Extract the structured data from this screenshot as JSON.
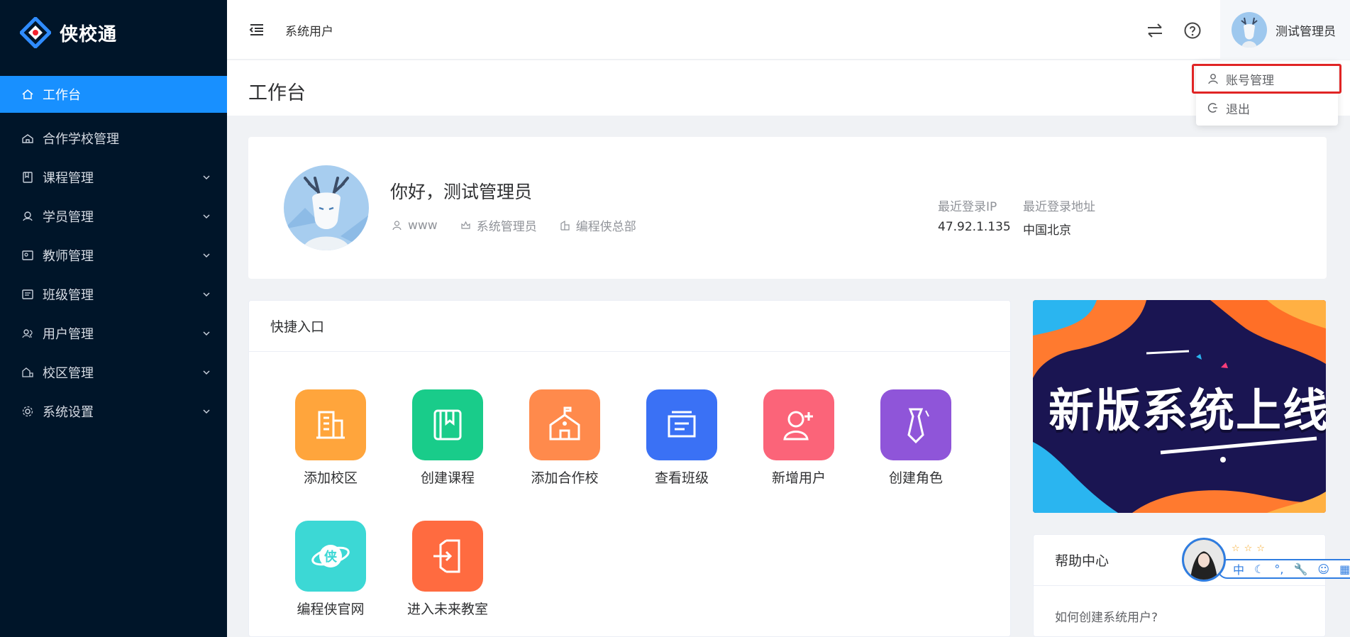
{
  "app": {
    "name": "侠校通"
  },
  "sidebar": {
    "items": [
      {
        "label": "工作台",
        "icon": "home-icon",
        "active": true
      },
      {
        "label": "合作学校管理",
        "icon": "school-icon"
      },
      {
        "label": "课程管理",
        "icon": "book-icon",
        "expandable": true
      },
      {
        "label": "学员管理",
        "icon": "student-icon",
        "expandable": true
      },
      {
        "label": "教师管理",
        "icon": "teacher-icon",
        "expandable": true
      },
      {
        "label": "班级管理",
        "icon": "class-icon",
        "expandable": true
      },
      {
        "label": "用户管理",
        "icon": "users-icon",
        "expandable": true
      },
      {
        "label": "校区管理",
        "icon": "campus-icon",
        "expandable": true
      },
      {
        "label": "系统设置",
        "icon": "gear-icon",
        "expandable": true
      }
    ]
  },
  "header": {
    "breadcrumb": "系统用户",
    "username": "测试管理员"
  },
  "dropdown": {
    "items": [
      {
        "label": "账号管理",
        "icon": "user-icon"
      },
      {
        "label": "退出",
        "icon": "logout-icon"
      }
    ]
  },
  "page": {
    "title": "工作台"
  },
  "welcome": {
    "greeting": "你好，测试管理员",
    "account": "www",
    "role": "系统管理员",
    "org": "编程侠总部",
    "last_ip_label": "最近登录IP",
    "last_ip": "47.92.1.135",
    "last_addr_label": "最近登录地址",
    "last_addr": "中国北京"
  },
  "quick": {
    "title": "快捷入口",
    "items": [
      {
        "label": "添加校区",
        "color": "#ffa53c",
        "icon": "building-icon"
      },
      {
        "label": "创建课程",
        "color": "#19cc8a",
        "icon": "book-icon"
      },
      {
        "label": "添加合作校",
        "color": "#ff8a4c",
        "icon": "school-icon"
      },
      {
        "label": "查看班级",
        "color": "#3a71f5",
        "icon": "board-icon"
      },
      {
        "label": "新增用户",
        "color": "#fb6479",
        "icon": "add-user-icon"
      },
      {
        "label": "创建角色",
        "color": "#8f55d9",
        "icon": "tie-icon"
      },
      {
        "label": "编程侠官网",
        "color": "#3cd8d5",
        "icon": "planet-icon"
      },
      {
        "label": "进入未来教室",
        "color": "#ff6b40",
        "icon": "enter-icon"
      }
    ]
  },
  "banner": {
    "text": "新版系统上线"
  },
  "help": {
    "title": "帮助中心",
    "items": [
      "如何创建系统用户?"
    ]
  },
  "ime": {
    "lang": "中",
    "stars": "☆☆☆"
  }
}
